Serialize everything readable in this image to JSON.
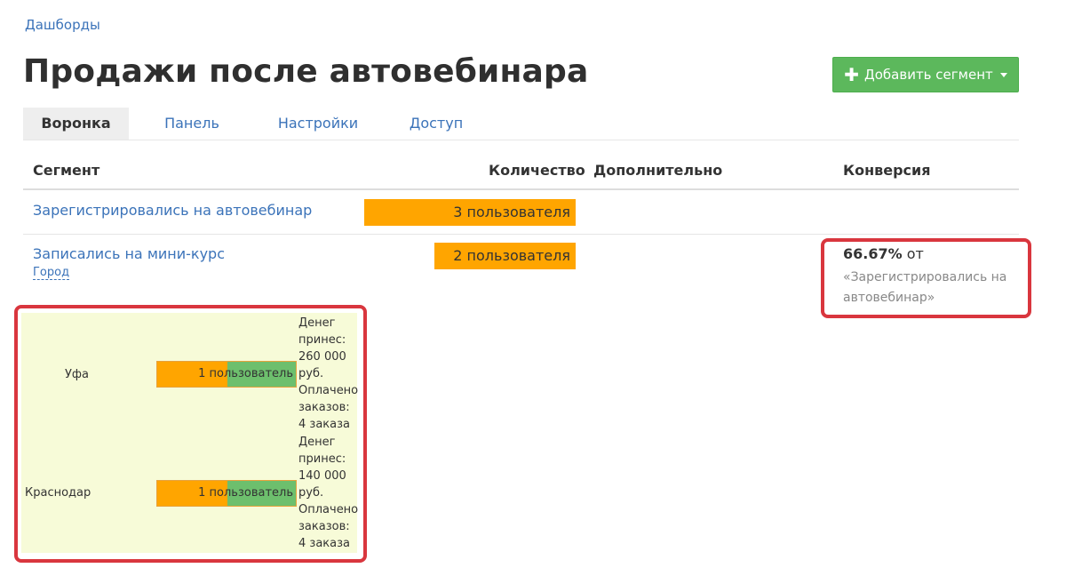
{
  "breadcrumb": "Дашборды",
  "title": "Продажи после автовебинара",
  "add_segment_button": "Добавить сегмент",
  "tabs": [
    "Воронка",
    "Панель",
    "Настройки",
    "Доступ"
  ],
  "table": {
    "headers": [
      "Сегмент",
      "Количество",
      "Дополнительно",
      "Конверсия"
    ],
    "rows": [
      {
        "segment": "Зарегистрировались на автовебинар",
        "count": "3 пользователя",
        "count_fraction": 1.0
      },
      {
        "segment": "Записались на мини-курс",
        "sub_link": "Город",
        "count": "2 пользователя",
        "count_fraction": 0.667,
        "conversion_pct": "66.67%",
        "conversion_from_word": "от",
        "conversion_ref": "«Зарегистрировались на автовебинар»"
      }
    ]
  },
  "city_breakdown": [
    {
      "city": "Уфа",
      "count": "1 пользователь",
      "money_label": "Денег принес:",
      "money_value": "260 000 руб.",
      "paid_label": "Оплачено заказов:",
      "paid_value": "4 заказа"
    },
    {
      "city": "Краснодар",
      "count": "1 пользователь",
      "money_label": "Денег принес:",
      "money_value": "140 000 руб.",
      "paid_label": "Оплачено заказов:",
      "paid_value": "4 заказа"
    }
  ],
  "colors": {
    "accent_green": "#5cb85c",
    "link_blue": "#3b73b9",
    "bar_orange": "#ffa500",
    "bar_green": "#6dbf6d",
    "highlight_red": "#d9363e",
    "panel_bg": "#f7fbd8"
  },
  "icons": [
    "plus-icon",
    "caret-down-icon"
  ]
}
